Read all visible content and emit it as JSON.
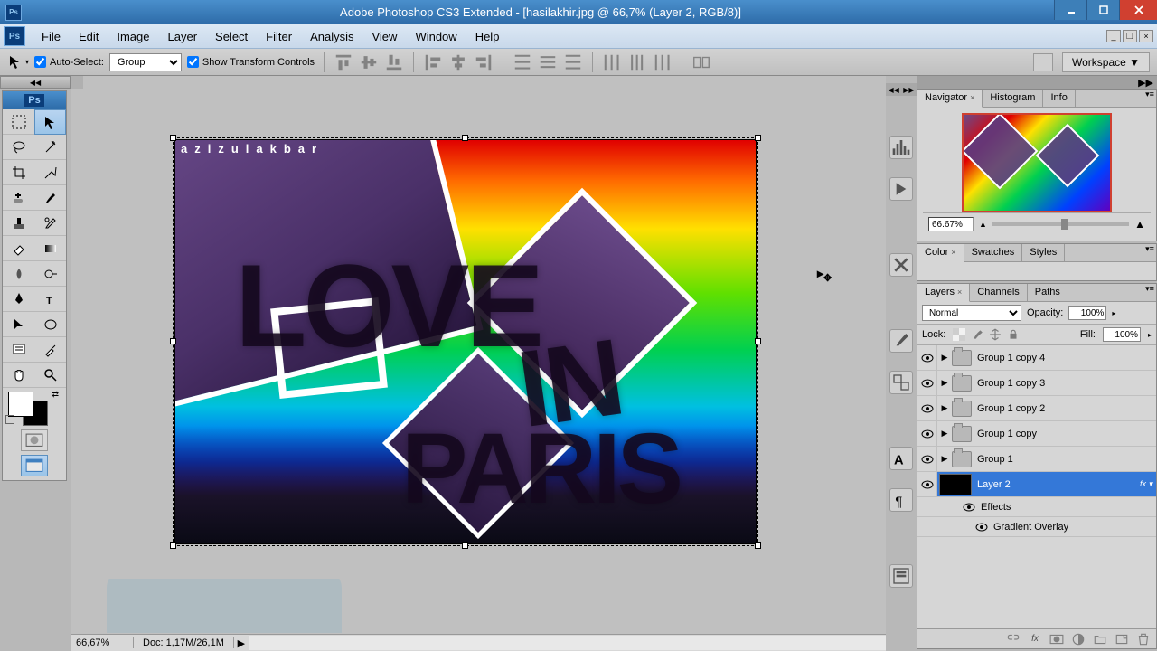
{
  "titlebar": {
    "app_icon_text": "Ps",
    "title": "Adobe Photoshop CS3 Extended - [hasilakhir.jpg @ 66,7% (Layer 2, RGB/8)]"
  },
  "menubar": {
    "ps_icon": "Ps",
    "items": [
      "File",
      "Edit",
      "Image",
      "Layer",
      "Select",
      "Filter",
      "Analysis",
      "View",
      "Window",
      "Help"
    ]
  },
  "optionsbar": {
    "auto_select": "Auto-Select:",
    "auto_select_mode": "Group",
    "show_transform": "Show Transform Controls",
    "workspace": "Workspace ▼"
  },
  "navigator": {
    "tabs": [
      "Navigator",
      "Histogram",
      "Info"
    ],
    "zoom": "66.67%"
  },
  "color": {
    "tabs": [
      "Color",
      "Swatches",
      "Styles"
    ]
  },
  "layers": {
    "tabs": [
      "Layers",
      "Channels",
      "Paths"
    ],
    "blend_mode": "Normal",
    "opacity_label": "Opacity:",
    "opacity_value": "100%",
    "lock_label": "Lock:",
    "fill_label": "Fill:",
    "fill_value": "100%",
    "items": [
      {
        "name": "Group 1 copy 4",
        "type": "group"
      },
      {
        "name": "Group 1 copy 3",
        "type": "group"
      },
      {
        "name": "Group 1 copy 2",
        "type": "group"
      },
      {
        "name": "Group 1 copy",
        "type": "group"
      },
      {
        "name": "Group 1",
        "type": "group"
      },
      {
        "name": "Layer 2",
        "type": "layer",
        "selected": true,
        "fx": true
      }
    ],
    "effects_label": "Effects",
    "effect_item": "Gradient Overlay"
  },
  "statusbar": {
    "zoom": "66,67%",
    "doc_size": "Doc: 1,17M/26,1M"
  },
  "artwork": {
    "watermark": "azizulakbar",
    "text1": "LOVE",
    "text2": "IN",
    "text3": "PARIS"
  }
}
